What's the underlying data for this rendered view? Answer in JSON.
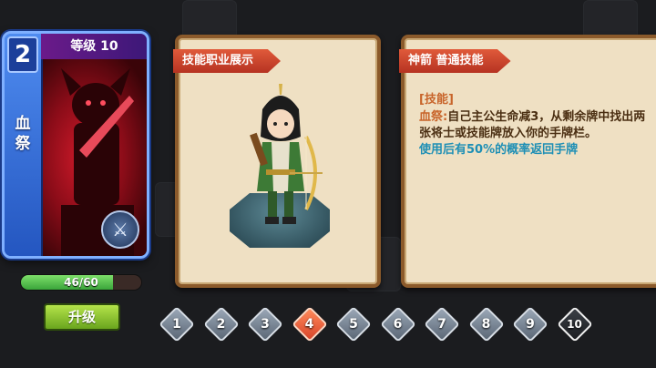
{
  "card": {
    "cost": "2",
    "name_chars": [
      "血",
      "祭"
    ],
    "level_label": "等级 10",
    "emblem_icon": "crossed-swords-icon"
  },
  "progress": {
    "text": "46/60",
    "current": 46,
    "max": 60
  },
  "upgrade_button": "升级",
  "left_panel": {
    "ribbon": "技能职业展示"
  },
  "right_panel": {
    "ribbon": "神箭 普通技能",
    "heading": "[技能]",
    "keyword": "血祭:",
    "desc_main": "自己主公生命减3，从剩余牌中找出两张将士或技能牌放入你的手牌栏。",
    "desc_highlight": "使用后有50%的概率返回手牌"
  },
  "levels": {
    "labels": [
      "1",
      "2",
      "3",
      "4",
      "5",
      "6",
      "7",
      "8",
      "9",
      "10"
    ],
    "active_index": 3,
    "max_index": 9
  },
  "colors": {
    "accent": "#c8642a",
    "highlight": "#1e8fb5",
    "card_blue": "#2456c0",
    "panel_bg": "#efe0c3"
  }
}
